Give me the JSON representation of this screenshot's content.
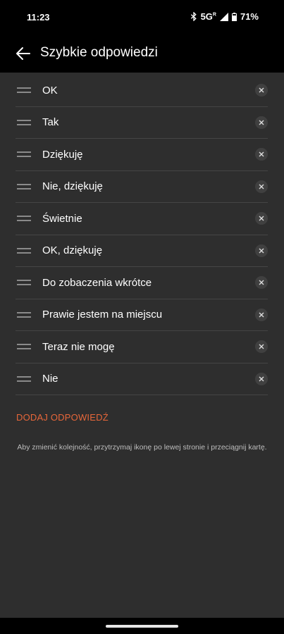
{
  "status": {
    "time": "11:23",
    "network": "5G",
    "network_sup": "R",
    "battery": "71%"
  },
  "header": {
    "title": "Szybkie odpowiedzi"
  },
  "replies": [
    {
      "label": "OK"
    },
    {
      "label": "Tak"
    },
    {
      "label": "Dziękuję"
    },
    {
      "label": "Nie, dziękuję"
    },
    {
      "label": "Świetnie"
    },
    {
      "label": "OK, dziękuję"
    },
    {
      "label": "Do zobaczenia wkrótce"
    },
    {
      "label": "Prawie jestem na miejscu"
    },
    {
      "label": "Teraz nie mogę"
    },
    {
      "label": "Nie"
    }
  ],
  "add_button": "DODAJ ODPOWIEDŹ",
  "hint": "Aby zmienić kolejność, przytrzymaj ikonę po lewej stronie i przeciągnij kartę.",
  "colors": {
    "accent": "#e8673a",
    "background": "#2e2e2e",
    "bar": "#000000"
  }
}
